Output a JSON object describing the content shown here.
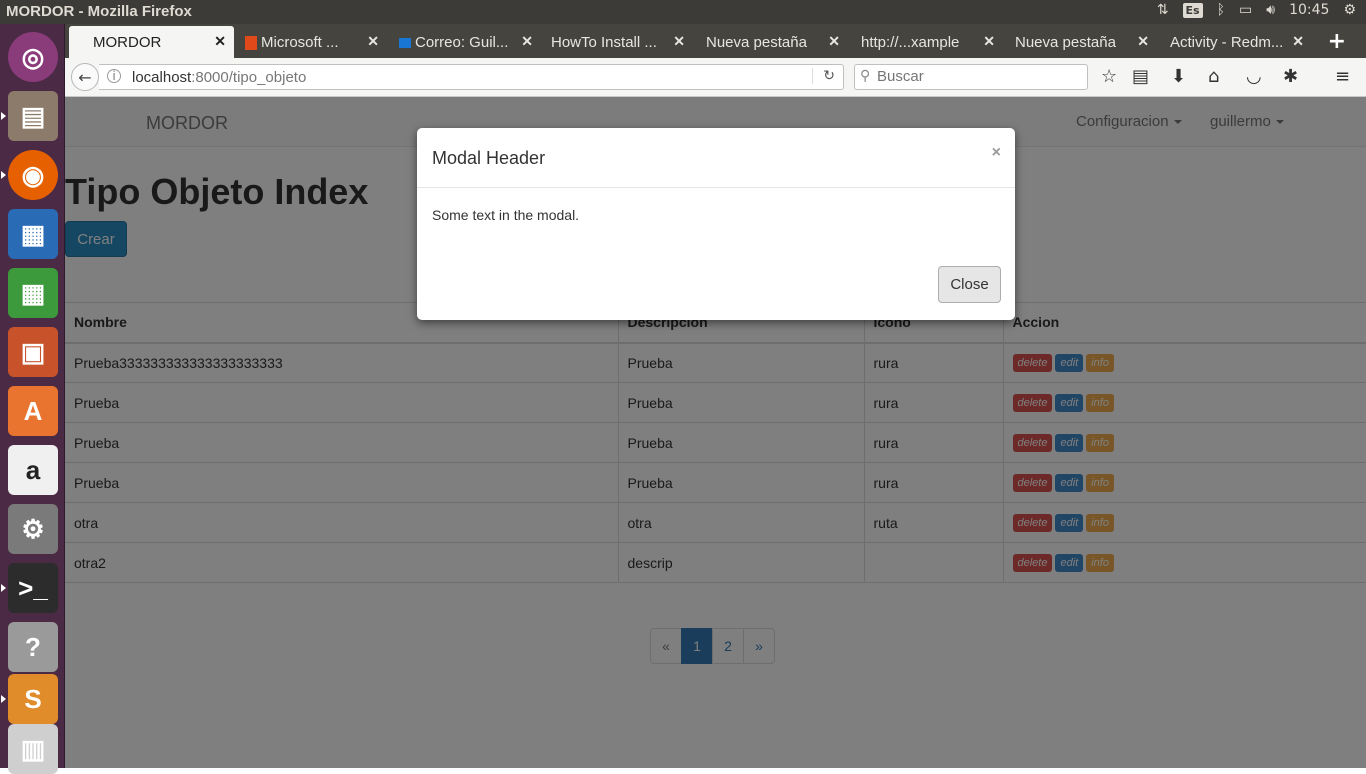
{
  "window_title": "MORDOR - Mozilla Firefox",
  "tray": {
    "keyboard": "Es",
    "time": "10:45"
  },
  "tabs": [
    {
      "label": "MORDOR"
    },
    {
      "label": "Microsoft ..."
    },
    {
      "label": "Correo: Guil..."
    },
    {
      "label": "HowTo Install ..."
    },
    {
      "label": "Nueva pestaña"
    },
    {
      "label": "http://...xample"
    },
    {
      "label": "Nueva pestaña"
    },
    {
      "label": "Activity - Redm..."
    }
  ],
  "address": {
    "host": "localhost",
    "rest": ":8000/tipo_objeto"
  },
  "search": {
    "placeholder": "Buscar"
  },
  "app": {
    "brand": "MORDOR",
    "nav": {
      "config": "Configuracion",
      "user": "guillermo"
    },
    "title": "Tipo Objeto Index",
    "create_button": "Crear"
  },
  "table": {
    "headers": [
      "Nombre",
      "Descripcion",
      "Icono",
      "Accion"
    ],
    "rows": [
      {
        "nombre": "Prueba333333333333333333333",
        "descripcion": "Prueba",
        "icono": "rura"
      },
      {
        "nombre": "Prueba",
        "descripcion": "Prueba",
        "icono": "rura"
      },
      {
        "nombre": "Prueba",
        "descripcion": "Prueba",
        "icono": "rura"
      },
      {
        "nombre": "Prueba",
        "descripcion": "Prueba",
        "icono": "rura"
      },
      {
        "nombre": "otra",
        "descripcion": "otra",
        "icono": "ruta"
      },
      {
        "nombre": "otra2",
        "descripcion": "descrip",
        "icono": ""
      }
    ],
    "actions": {
      "delete": "delete",
      "edit": "edit",
      "info": "info"
    }
  },
  "pagination": {
    "prev": "«",
    "pages": [
      "1",
      "2"
    ],
    "next": "»",
    "current": "1"
  },
  "modal": {
    "title": "Modal Header",
    "close_x": "×",
    "body": "Some text in the modal.",
    "close_button": "Close"
  },
  "colors": {
    "delete": "#d9534f",
    "edit": "#428bca",
    "info": "#f0ad4e",
    "primary": "#2c8fc4"
  }
}
